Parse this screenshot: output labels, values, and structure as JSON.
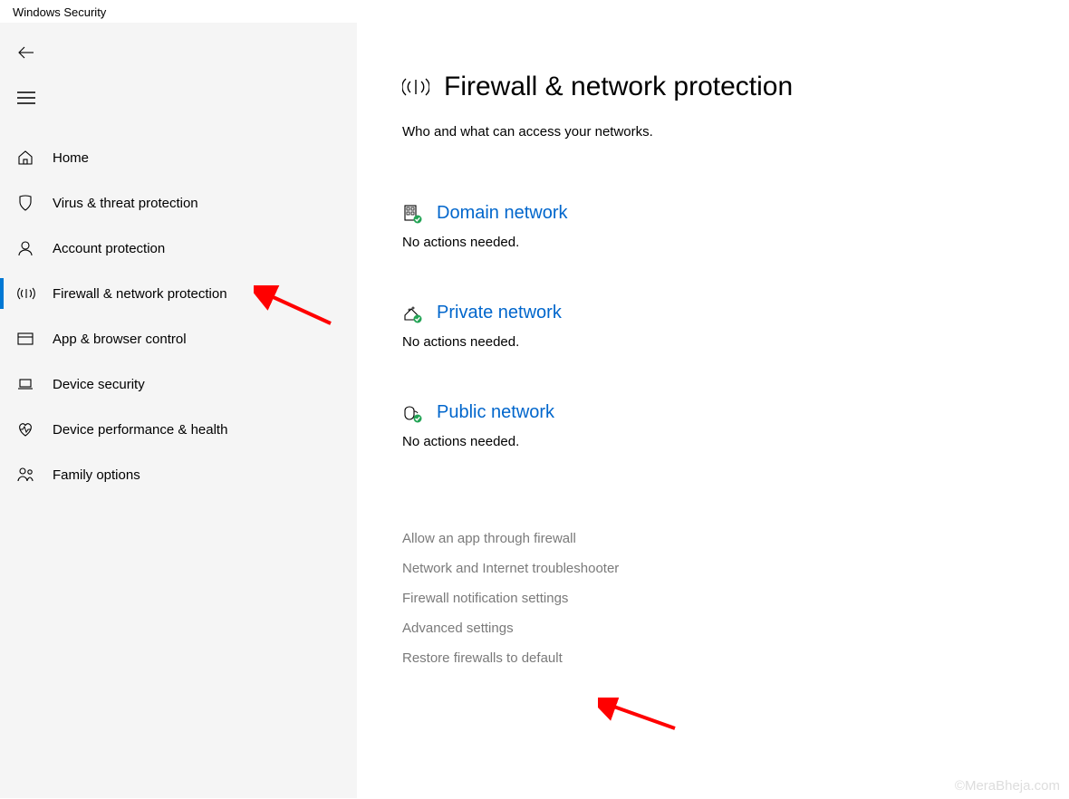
{
  "window": {
    "title": "Windows Security"
  },
  "sidebar": {
    "items": [
      {
        "label": "Home"
      },
      {
        "label": "Virus & threat protection"
      },
      {
        "label": "Account protection"
      },
      {
        "label": "Firewall & network protection"
      },
      {
        "label": "App & browser control"
      },
      {
        "label": "Device security"
      },
      {
        "label": "Device performance & health"
      },
      {
        "label": "Family options"
      }
    ]
  },
  "page": {
    "title": "Firewall & network protection",
    "subtitle": "Who and what can access your networks."
  },
  "networks": [
    {
      "title": "Domain network",
      "status": "No actions needed."
    },
    {
      "title": "Private network",
      "status": "No actions needed."
    },
    {
      "title": "Public network",
      "status": "No actions needed."
    }
  ],
  "links": [
    "Allow an app through firewall",
    "Network and Internet troubleshooter",
    "Firewall notification settings",
    "Advanced settings",
    "Restore firewalls to default"
  ],
  "watermark": "©MeraBheja.com"
}
